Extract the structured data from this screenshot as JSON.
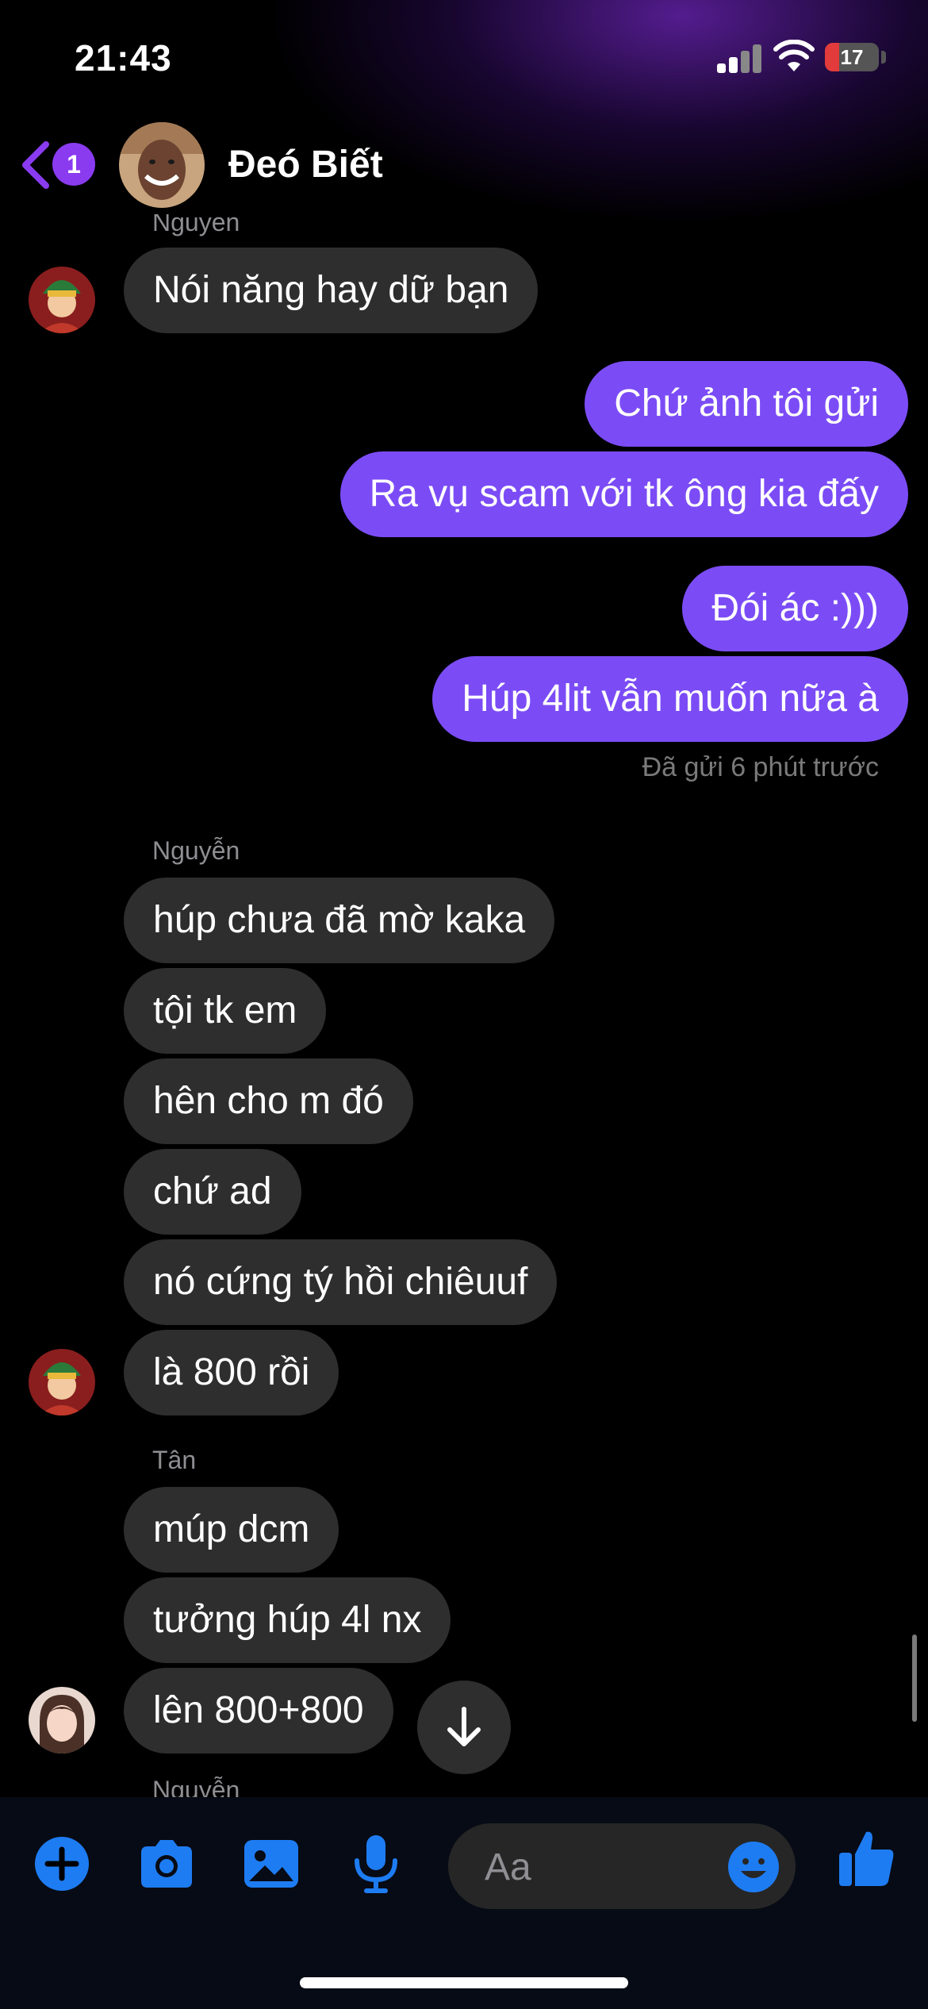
{
  "status_bar": {
    "time": "21:43",
    "battery": "17",
    "battery_fraction": 0.17
  },
  "header": {
    "unread_count": "1",
    "title": "Đeó Biết"
  },
  "messages": [
    {
      "sender_label": "Nguyen"
    },
    {
      "text": "Nói năng hay dữ bạn"
    },
    {
      "text": "Chứ ảnh tôi gửi"
    },
    {
      "text": "Ra vụ scam với tk ông kia đấy"
    },
    {
      "text": "Đói ác :)))"
    },
    {
      "text": "Húp 4lit vẫn muốn nữa à"
    },
    {
      "text": "Đã gửi 6 phút trước"
    },
    {
      "sender_label": "Nguyễn"
    },
    {
      "text": "húp chưa đã mờ kaka"
    },
    {
      "text": "tội tk em"
    },
    {
      "text": "hên cho m đó"
    },
    {
      "text": "chứ ad"
    },
    {
      "text": "nó cứng tý hồi chiêuuf"
    },
    {
      "text": "là 800 rồi"
    },
    {
      "sender_label": "Tân"
    },
    {
      "text": "múp dcm"
    },
    {
      "text": "tưởng húp 4l nx"
    },
    {
      "text": "lên 800+800"
    },
    {
      "sender_label": "Nguyễn"
    }
  ],
  "composer": {
    "placeholder": "Aa"
  },
  "colors": {
    "accent": "#7b4cf6",
    "icon_blue": "#1e7cf2",
    "bubble_in": "#2e2e2e",
    "back_purple": "#8a3bf0"
  },
  "icons": [
    "back-chevron-icon",
    "plus-icon",
    "camera-icon",
    "gallery-icon",
    "microphone-icon",
    "emoji-icon",
    "thumbs-up-icon",
    "arrow-down-icon"
  ]
}
